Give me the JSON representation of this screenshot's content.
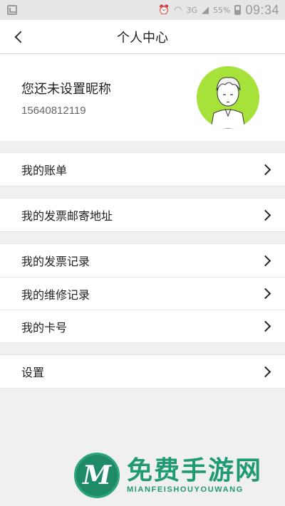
{
  "status_bar": {
    "signal": "3G",
    "battery": "55%",
    "time": "09:34"
  },
  "navbar": {
    "title": "个人中心"
  },
  "profile": {
    "nickname": "您还未设置昵称",
    "phone": "15640812119"
  },
  "menu_groups": [
    [
      {
        "label": "我的账单"
      }
    ],
    [
      {
        "label": "我的发票邮寄地址"
      }
    ],
    [
      {
        "label": "我的发票记录"
      },
      {
        "label": "我的维修记录"
      },
      {
        "label": "我的卡号"
      }
    ],
    [
      {
        "label": "设置"
      }
    ]
  ],
  "watermark": {
    "logo_letter": "M",
    "text_cn": "免费手游网",
    "text_en": "MIANFEISHOUYOUWANG"
  },
  "colors": {
    "avatar_bg": "#a6e23a",
    "watermark_green": "#1f9a72"
  }
}
